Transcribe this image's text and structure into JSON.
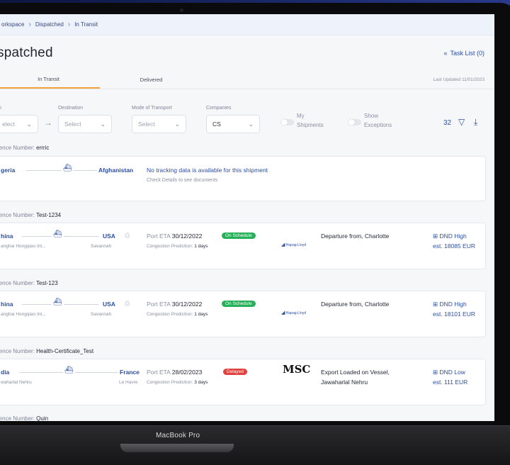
{
  "breadcrumb": {
    "items": [
      "orkspace",
      "Dispatched",
      "In Transit"
    ]
  },
  "page": {
    "title": "spatched",
    "task_list": "Task List (0)"
  },
  "tabs": {
    "in_transit": "In Transit",
    "delivered": "Delivered",
    "last_updated": "Last Updated 11/01/2023"
  },
  "filters": {
    "origin_select": "elect",
    "destination_label": "Destination",
    "destination_select": "Select",
    "mode_label": "Mode of Transport",
    "mode_select": "Select",
    "companies_label": "Companies",
    "companies_select": "CS",
    "my_shipments_line1": "My",
    "my_shipments_line2": "Shipments",
    "show_exceptions_line1": "Show",
    "show_exceptions_line2": "Exceptions",
    "count": "32"
  },
  "shipments": [
    {
      "ref_label": "rence Number:",
      "ref": "errric",
      "origin": "geria",
      "origin_port": "",
      "destination": "Afghanistan",
      "dest_port": "",
      "message": "No tracking data is available for this shipment",
      "sub_message": "Check Details to see documents"
    },
    {
      "ref_label": "rence Number:",
      "ref": "Test-1234",
      "origin": "hina",
      "origin_port": "anghai Hongqiao Int...",
      "destination": "USA",
      "dest_port": "Savannah",
      "port_eta_label": "Port ETA",
      "port_eta": "30/12/2022",
      "status": "On Schedule",
      "congestion_label": "Congestion Prediction:",
      "congestion": "1 days",
      "carrier": "Hapag-Lloyd",
      "event_line1": "Departure from, Charlotte",
      "event_line2": "",
      "dnd_line1": "DND High",
      "dnd_line2": "est. 18085 EUR"
    },
    {
      "ref_label": "rence Number:",
      "ref": "Test-123",
      "origin": "hina",
      "origin_port": "anghai Hongqiao Int...",
      "destination": "USA",
      "dest_port": "Savannah",
      "port_eta_label": "Port ETA",
      "port_eta": "30/12/2022",
      "status": "On Schedule",
      "congestion_label": "Congestion Prediction:",
      "congestion": "1 days",
      "carrier": "Hapag-Lloyd",
      "event_line1": "Departure from, Charlotte",
      "event_line2": "",
      "dnd_line1": "DND High",
      "dnd_line2": "est. 18101 EUR"
    },
    {
      "ref_label": "rence Number:",
      "ref": "Health-Certificate_Test",
      "origin": "dia",
      "origin_port": "waharlal Nehru",
      "destination": "France",
      "dest_port": "Le Havre",
      "port_eta_label": "Port ETA",
      "port_eta": "28/02/2023",
      "status": "Delayed",
      "congestion_label": "Congestion Prediction:",
      "congestion": "3 days",
      "carrier_logo": "MSC",
      "event_line1": "Export Loaded on Vessel,",
      "event_line2": "Jawaharlal Nehru",
      "dnd_line1": "DND Low",
      "dnd_line2": "est. 111 EUR"
    },
    {
      "ref_label": "rence Number:",
      "ref": "Quin"
    }
  ],
  "device": {
    "label": "MacBook Pro"
  },
  "colors": {
    "accent": "#2b4ea3",
    "tab_underline": "#f0a13b",
    "on_schedule": "#27b05a",
    "delayed": "#e0413e"
  }
}
